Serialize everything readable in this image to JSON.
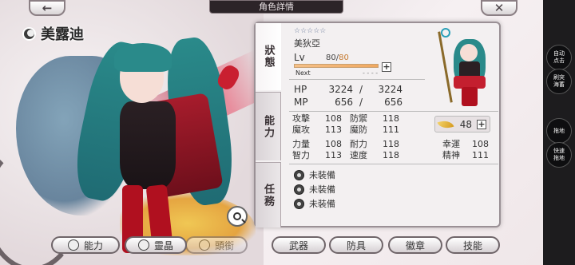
{
  "header": {
    "title": "角色詳情",
    "back_icon": "←",
    "close_icon": "✕"
  },
  "character": {
    "name": "美露迪"
  },
  "tabs": [
    {
      "label": "狀態"
    },
    {
      "label": "能力"
    },
    {
      "label": "任務"
    }
  ],
  "status": {
    "stars": "☆☆☆☆☆",
    "sub_name": "美狄亞",
    "lv_label": "Lv",
    "lv_current": "80",
    "lv_separator": "/",
    "lv_max": "80",
    "next_label": "Next",
    "next_value": "- - - -",
    "exp_fraction": 1.0,
    "hp_label": "HP",
    "hp_current": "3224",
    "hp_max": "3224",
    "mp_label": "MP",
    "mp_current": "656",
    "mp_max": "656",
    "separator": "/"
  },
  "attributes_left": [
    {
      "k1": "攻擊",
      "v1": "108",
      "k2": "防禦",
      "v2": "118"
    },
    {
      "k1": "魔攻",
      "v1": "113",
      "k2": "魔防",
      "v2": "111"
    },
    {
      "k1": "力量",
      "v1": "108",
      "k2": "耐力",
      "v2": "118"
    },
    {
      "k1": "智力",
      "v1": "113",
      "k2": "速度",
      "v2": "118"
    }
  ],
  "feather": {
    "value": "48",
    "plus": "+"
  },
  "attributes_right": [
    {
      "k": "幸運",
      "v": "108"
    },
    {
      "k": "精神",
      "v": "111"
    }
  ],
  "equipment": [
    {
      "label": "未裝備"
    },
    {
      "label": "未裝備"
    },
    {
      "label": "未裝備"
    }
  ],
  "bottom_buttons": {
    "ability": "能力",
    "stone": "靈晶",
    "title": "頭銜",
    "weapon": "武器",
    "armor": "防具",
    "badge": "徽章",
    "skill": "技能"
  },
  "sidebar": {
    "auto_click": "自动\n点击",
    "auto_sweep": "刷突\n海蓄",
    "drag": "拖地",
    "quick_drag": "快速\n拖地"
  },
  "colors": {
    "lv_max": "#c57a30",
    "panel_bg": "#f3f0f1",
    "title_bar": "#2c2428"
  }
}
